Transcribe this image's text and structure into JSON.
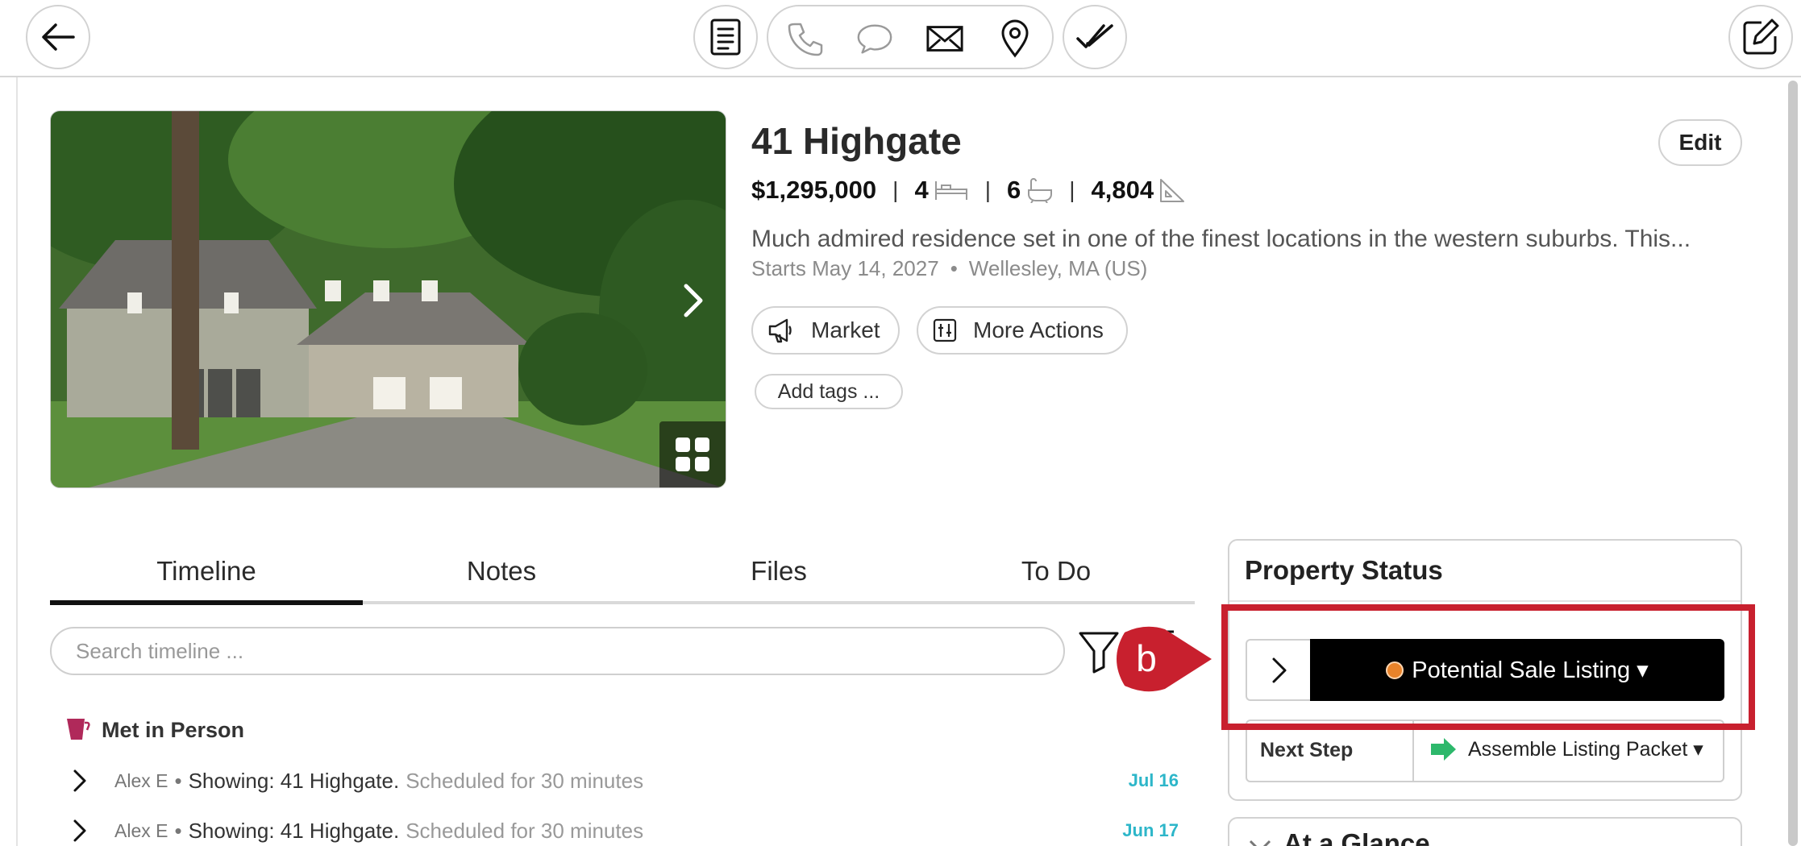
{
  "toolbar": {
    "back_icon": "arrow-left-icon",
    "notes_icon": "document-icon",
    "contact_icons": [
      "phone-icon",
      "chat-bubble-icon",
      "envelope-icon",
      "map-pin-icon"
    ],
    "task_icon": "checkmark-icon",
    "edit_icon": "compose-icon"
  },
  "property": {
    "title": "41 Highgate",
    "edit_label": "Edit",
    "price": "$1,295,000",
    "beds": "4",
    "baths": "6",
    "sqft": "4,804",
    "description": "Much admired residence set in one of the finest locations in the western suburbs. This...",
    "starts": "Starts May 14, 2027",
    "meta_separator": "•",
    "location": "Wellesley, MA (US)",
    "market_label": "Market",
    "more_actions_label": "More Actions",
    "add_tags_label": "Add tags ..."
  },
  "tabs": [
    "Timeline",
    "Notes",
    "Files",
    "To Do"
  ],
  "active_tab": "Timeline",
  "search": {
    "placeholder": "Search timeline ..."
  },
  "timeline": {
    "group_title": "Met in Person",
    "items": [
      {
        "who": "Alex E",
        "bullet": "•",
        "what": "Showing: 41 Highgate.",
        "detail": "Scheduled for 30 minutes",
        "date": "Jul 16"
      },
      {
        "who": "Alex E",
        "bullet": "•",
        "what": "Showing: 41 Highgate.",
        "detail": "Scheduled for 30 minutes",
        "date": "Jun 17"
      }
    ]
  },
  "property_status": {
    "title": "Property Status",
    "status_value": "Potential Sale Listing ▾",
    "status_color": "#e9832a",
    "next_step_label": "Next Step",
    "next_step_value": "Assemble Listing Packet ▾",
    "next_step_arrow_color": "#2db86b"
  },
  "annotation": {
    "callout_letter": "b",
    "color": "#c8202e"
  },
  "at_a_glance": {
    "title": "At a Glance"
  }
}
